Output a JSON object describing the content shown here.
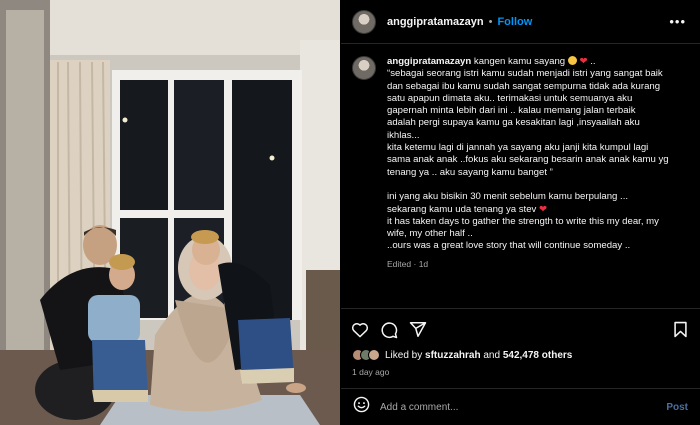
{
  "post": {
    "username": "anggipratamazayn",
    "follow_label": "Follow",
    "header_separator": "•",
    "more_label": "•••"
  },
  "caption": {
    "username": "anggipratamazayn",
    "first_text": "kangen kamu sayang",
    "first_suffix": "..",
    "lines_block1": [
      "“sebagai seorang istri kamu sudah menjadi istri yang sangat baik",
      "dan sebagai ibu kamu sudah sangat sempurna tidak ada kurang",
      "satu apapun dimata aku.. terimakasi untuk semuanya aku",
      "gapernah minta lebih dari ini .. kalau memang jalan terbaik",
      "adalah pergi supaya kamu ga kesakitan lagi ,insyaallah aku",
      "ikhlas...",
      "kita ketemu lagi di jannah ya sayang aku janji kita kumpul lagi",
      "sama anak anak ..fokus aku sekarang besarin anak anak kamu yg",
      "tenang ya .. aku sayang kamu banget ”"
    ],
    "lines_block2": [
      "ini yang aku bisikin 30 menit sebelum kamu berpulang ...",
      "sekarang kamu uda tenang ya stev",
      "it has taken days to gather the strength to write this my dear, my",
      "wife, my other half ..",
      "..ours was a great love story that will continue someday .."
    ],
    "edited_label": "Edited",
    "edited_dot": "·",
    "edited_age": "1d"
  },
  "actions": {
    "likes_prefix": "Liked by",
    "liker_name": "sftuzzahrah",
    "likes_and": "and",
    "likes_count": "542,478 others",
    "time_ago": "1 day ago"
  },
  "comment": {
    "placeholder": "Add a comment...",
    "post_label": "Post"
  },
  "colors": {
    "background": "#000000",
    "link_blue": "#0095f6",
    "heart_red": "#ed2e3f",
    "muted_text": "#a8a8a8"
  },
  "icons": [
    "heart-outline-icon",
    "comment-icon",
    "share-icon",
    "bookmark-icon",
    "emoji-icon",
    "more-icon"
  ]
}
